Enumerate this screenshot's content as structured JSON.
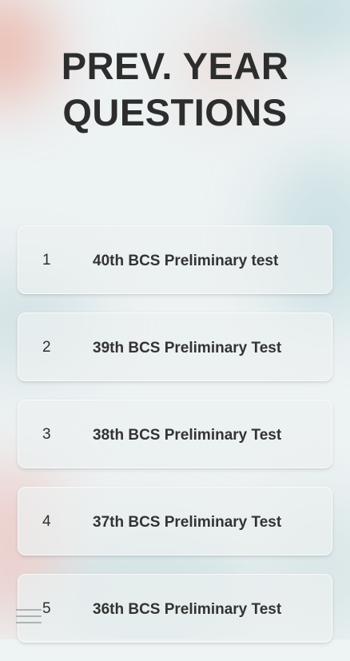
{
  "page": {
    "title_line1": "PREV. YEAR",
    "title_line2": "QUESTIONS"
  },
  "questions": [
    {
      "number": "1",
      "label": "40th BCS Preliminary test"
    },
    {
      "number": "2",
      "label": "39th BCS Preliminary Test"
    },
    {
      "number": "3",
      "label": "38th BCS Preliminary Test"
    },
    {
      "number": "4",
      "label": "37th BCS Preliminary Test"
    },
    {
      "number": "5",
      "label": "36th BCS Preliminary Test"
    }
  ],
  "menu": {
    "icon": "hamburger-menu-icon"
  }
}
